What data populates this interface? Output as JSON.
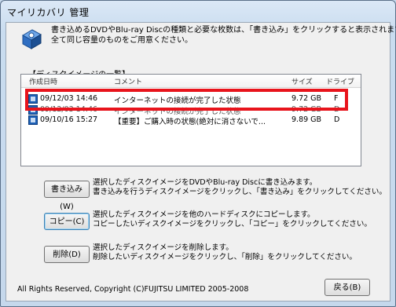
{
  "window": {
    "title": "マイリカバリ 管理"
  },
  "intro": "書き込めるDVDやBlu-ray Discの種類と必要な枚数は、「書き込み」をクリックすると表示されます。\n全て同じ容量のものをご用意ください。",
  "list": {
    "group_label": "【ディスクイメージの一覧】",
    "columns": [
      "作成日時",
      "コメント",
      "サイズ",
      "ドライブ"
    ],
    "rows": [
      {
        "date": "09/12/03 14:46",
        "comment": "インターネットの接続が完了した状態",
        "size": "9.72 GB",
        "drive": "F"
      },
      {
        "date": "09/12/03 14:46",
        "comment": "インターネットの接続が完了した状態",
        "size": "9.72 GB",
        "drive": "D"
      },
      {
        "date": "09/10/16 15:27",
        "comment": "【重要】ご購入時の状態(絶対に消さないで...",
        "size": "9.89 GB",
        "drive": "D"
      }
    ]
  },
  "actions": {
    "write": {
      "label": "書き込み(W)",
      "desc": "選択したディスクイメージをDVDやBlu-ray Discに書き込みます。\n書き込みを行うディスクイメージをクリックし、「書き込み」をクリックしてください。"
    },
    "copy": {
      "label": "コピー(C)",
      "desc": "選択したディスクイメージを他のハードディスクにコピーします。\nコピーしたいディスクイメージをクリックし、「コピー」をクリックしてください。"
    },
    "delete": {
      "label": "削除(D)",
      "desc": "選択したディスクイメージを削除します。\n削除したいディスクイメージをクリックし、「削除」をクリックしてください。"
    }
  },
  "footer": {
    "copyright": "All Rights Reserved, Copyright (C)FUJITSU LIMITED 2005-2008",
    "back_label": "戻る(B)"
  },
  "colors": {
    "highlight": "#e8141c",
    "accent": "#1c5fb5"
  }
}
